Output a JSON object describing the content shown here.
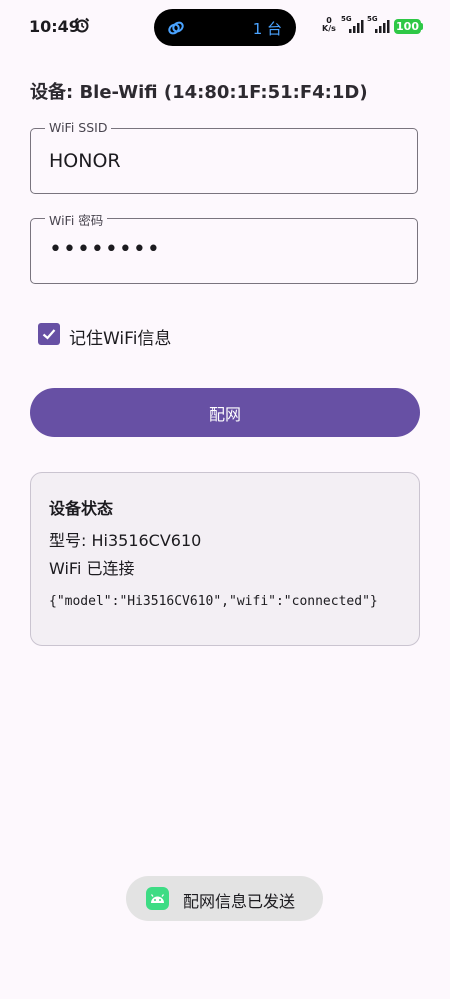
{
  "status_bar": {
    "time": "10:49",
    "island_count": "1 台",
    "net_speed_value": "0",
    "net_speed_unit": "K/s",
    "signal1_tag": "5G",
    "signal2_tag": "5G",
    "battery": "100"
  },
  "device": {
    "title": "设备: Ble-Wifi (14:80:1F:51:F4:1D)"
  },
  "ssid_field": {
    "label": "WiFi SSID",
    "value": "HONOR"
  },
  "password_field": {
    "label": "WiFi 密码",
    "value": "••••••••"
  },
  "remember": {
    "label": "记住WiFi信息",
    "checked": true
  },
  "configure_button": {
    "label": "配网"
  },
  "status_card": {
    "title": "设备状态",
    "model_line": "型号: Hi3516CV610",
    "wifi_line": "WiFi 已连接",
    "raw_json": "{\"model\":\"Hi3516CV610\",\"wifi\":\"connected\"}"
  },
  "toast": {
    "message": "配网信息已发送"
  },
  "colors": {
    "accent": "#6750a4",
    "battery": "#2ec846",
    "toast_icon": "#3ddc84"
  }
}
